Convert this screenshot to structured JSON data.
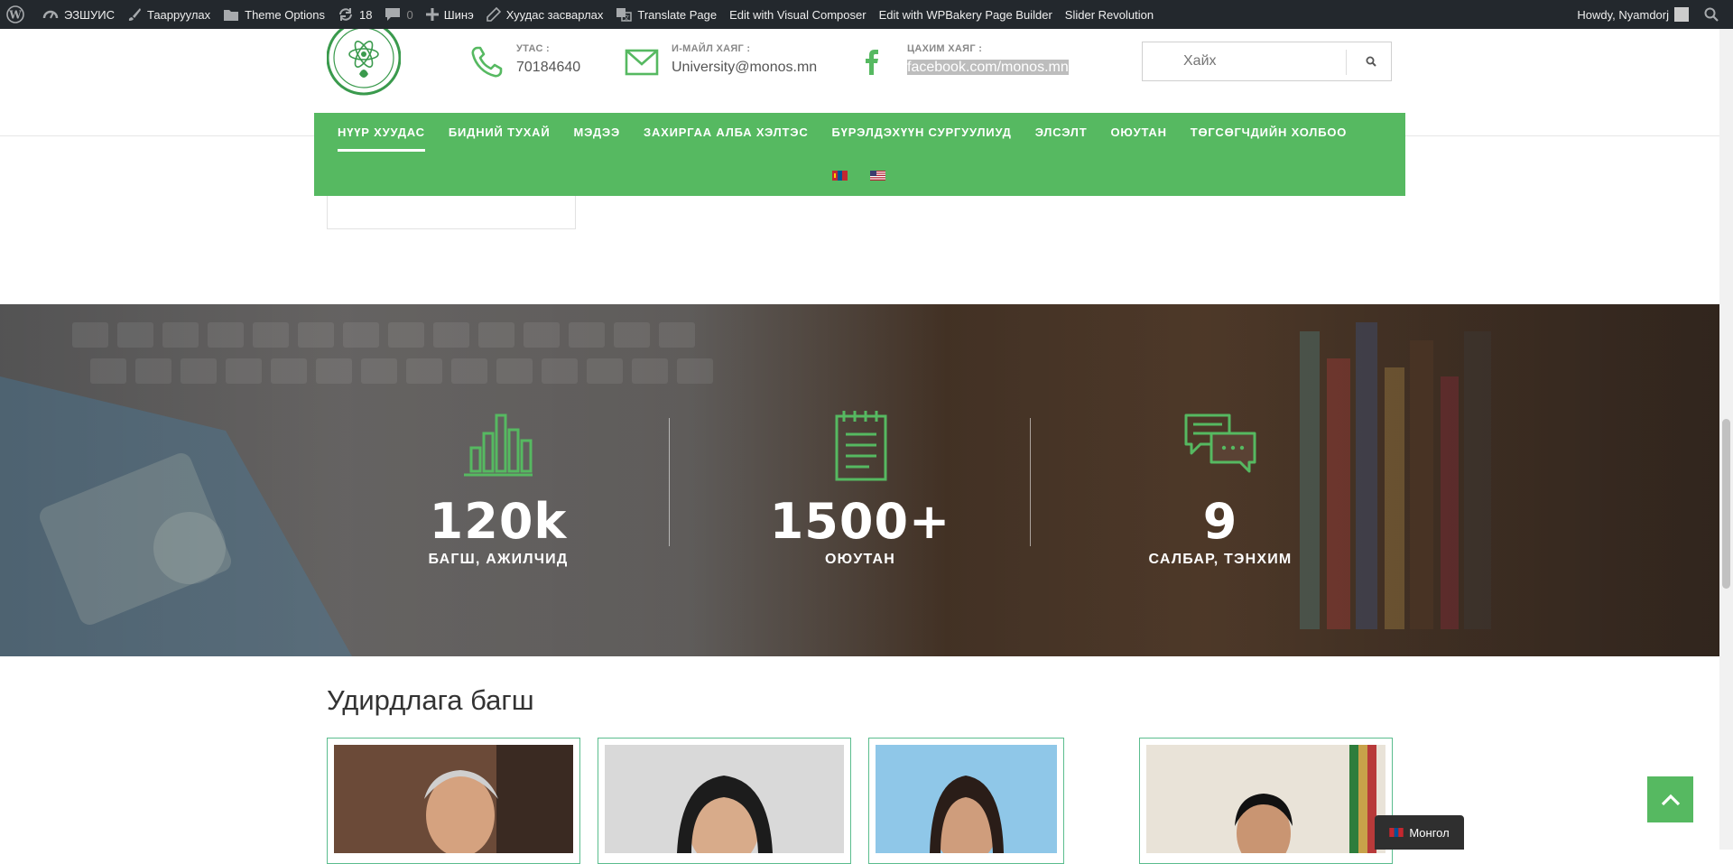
{
  "admin_bar": {
    "site_name": "ЭЗШУИС",
    "customize": "Таарруулах",
    "theme_options": "Theme Options",
    "updates_count": "18",
    "comments_count": "0",
    "new": "Шинэ",
    "edit_page": "Хуудас засварлах",
    "translate_page": "Translate Page",
    "edit_visual_composer": "Edit with Visual Composer",
    "edit_wpbakery": "Edit with WPBakery Page Builder",
    "slider_revolution": "Slider Revolution",
    "howdy": "Howdy, Nyamdorj"
  },
  "header": {
    "phone": {
      "label": "УТАС :",
      "value": "70184640"
    },
    "email": {
      "label": "И-МАЙЛ ХАЯГ :",
      "value": "University@monos.mn"
    },
    "facebook": {
      "label": "ЦАХИМ ХАЯГ :",
      "value": "facebook.com/monos.mn"
    },
    "search": {
      "placeholder": "Хайх"
    }
  },
  "nav": {
    "items": [
      {
        "label": "НҮҮР ХУУДАС",
        "active": true
      },
      {
        "label": "БИДНИЙ ТУХАЙ"
      },
      {
        "label": "МЭДЭЭ"
      },
      {
        "label": "ЗАХИРГАА АЛБА ХЭЛТЭС"
      },
      {
        "label": "БҮРЭЛДЭХҮҮН СУРГУУЛИУД"
      },
      {
        "label": "ЭЛСЭЛТ"
      },
      {
        "label": "ОЮУТАН"
      },
      {
        "label": "ТӨГСӨГЧДИЙН ХОЛБОО"
      }
    ],
    "languages": [
      "mn-flag",
      "us-flag"
    ]
  },
  "stats": [
    {
      "number": "120k",
      "label": "БАГШ, АЖИЛЧИД",
      "icon": "bar-chart-icon"
    },
    {
      "number": "1500+",
      "label": "ОЮУТАН",
      "icon": "notepad-icon"
    },
    {
      "number": "9",
      "label": "САЛБАР, ТЭНХИМ",
      "icon": "chat-bubbles-icon"
    }
  ],
  "leaders": {
    "title": "Удирдлага багш"
  },
  "language_switcher": "Монгол",
  "colors": {
    "accent": "#56b961",
    "admin_bar": "#23282d"
  }
}
